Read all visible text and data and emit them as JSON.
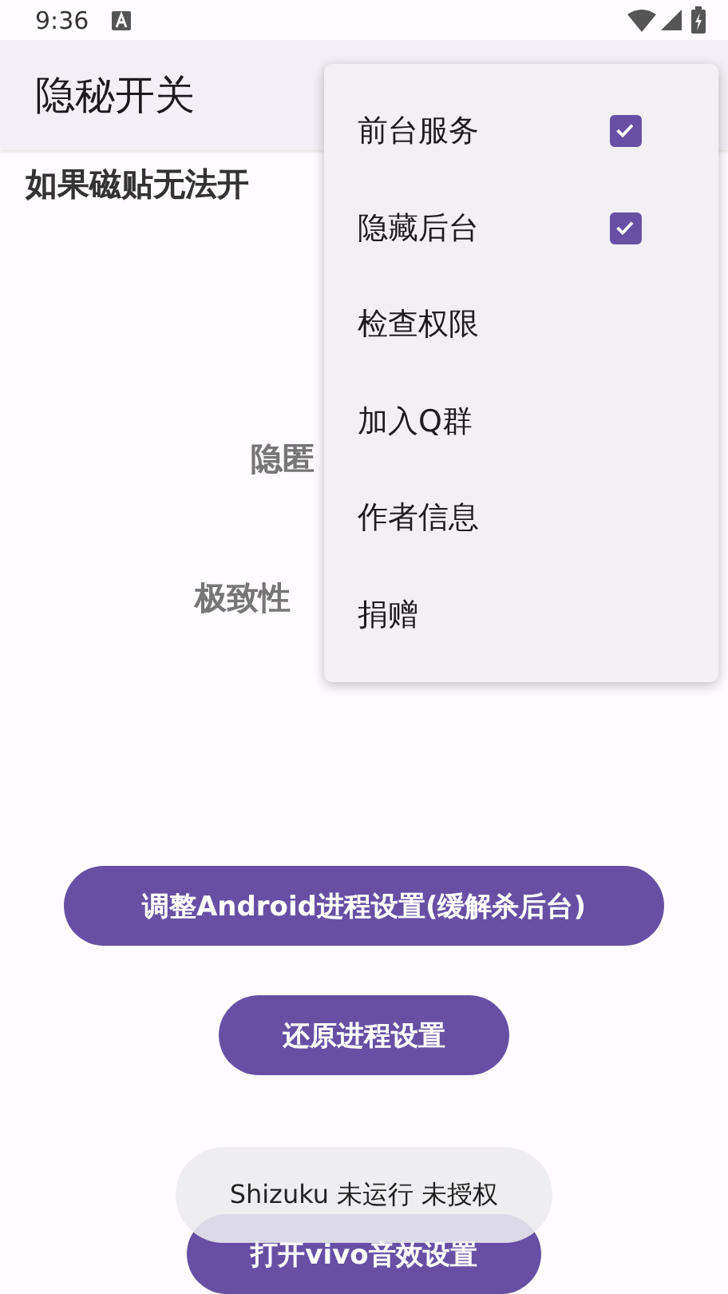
{
  "status_bar": {
    "time": "9:36"
  },
  "app_bar": {
    "title": "隐秘开关"
  },
  "content": [
    {
      "kind": "notice",
      "text": "如果磁贴无法开"
    },
    {
      "kind": "label",
      "text": "隐匿"
    },
    {
      "kind": "label",
      "text": "极致性"
    }
  ],
  "buttons": [
    "调整Android进程设置(缓解杀后台)",
    "还原进程设置",
    "打开vivo音效设置"
  ],
  "menu": [
    {
      "kind": "check",
      "label": "前台服务",
      "checked": true
    },
    {
      "kind": "check",
      "label": "隐藏后台",
      "checked": true
    },
    {
      "kind": "plain",
      "label": "检查权限"
    },
    {
      "kind": "plain",
      "label": "加入Q群"
    },
    {
      "kind": "plain",
      "label": "作者信息"
    },
    {
      "kind": "plain",
      "label": "捐赠"
    }
  ],
  "toast": "Shizuku 未运行 未授权"
}
